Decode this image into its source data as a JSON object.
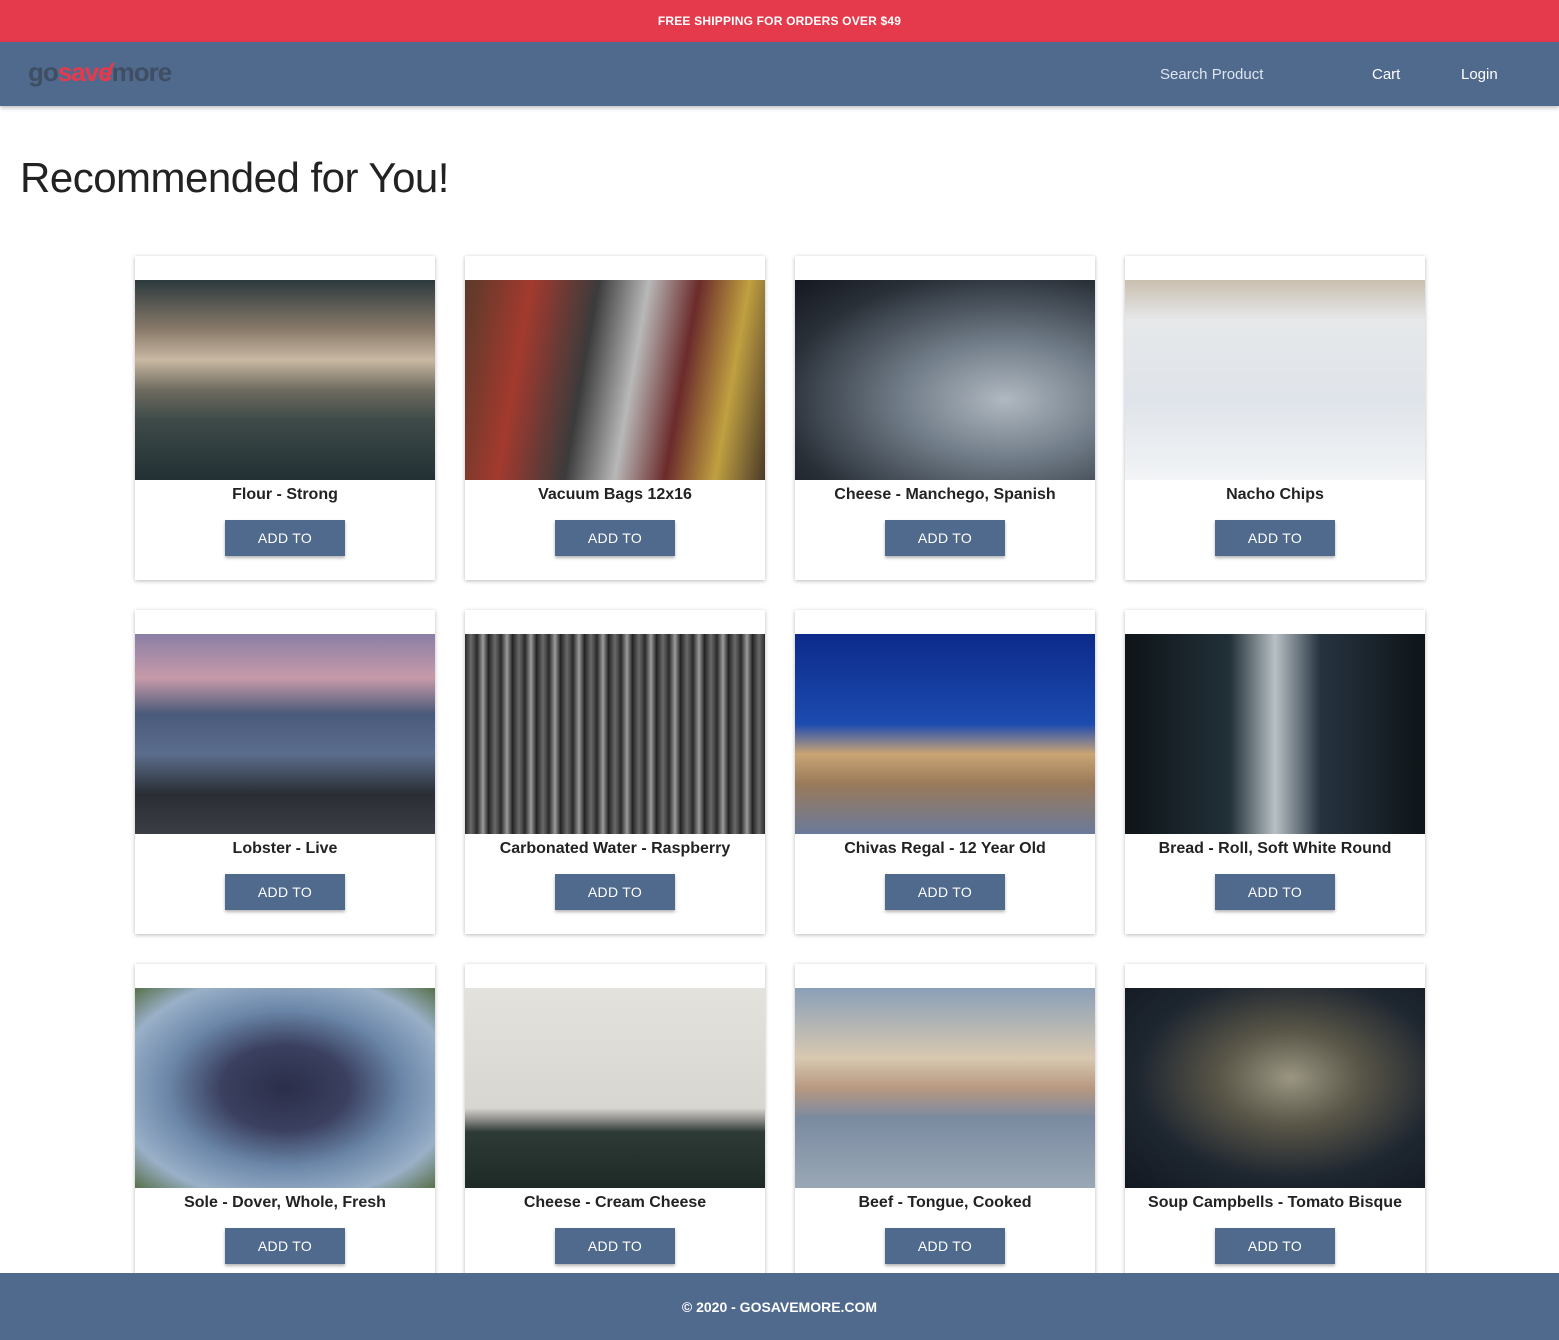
{
  "promo": {
    "text": "FREE SHIPPING FOR ORDERS OVER $49"
  },
  "header": {
    "logo": {
      "part1": "go",
      "part2": "save",
      "part3": "more"
    },
    "search_label": "Search Product",
    "cart_label": "Cart",
    "login_label": "Login"
  },
  "main": {
    "heading": "Recommended for You!",
    "products": [
      {
        "name": "Flour - Strong",
        "button": "ADD TO"
      },
      {
        "name": "Vacuum Bags 12x16",
        "button": "ADD TO"
      },
      {
        "name": "Cheese - Manchego, Spanish",
        "button": "ADD TO"
      },
      {
        "name": "Nacho Chips",
        "button": "ADD TO"
      },
      {
        "name": "Lobster - Live",
        "button": "ADD TO"
      },
      {
        "name": "Carbonated Water - Raspberry",
        "button": "ADD TO"
      },
      {
        "name": "Chivas Regal - 12 Year Old",
        "button": "ADD TO"
      },
      {
        "name": "Bread - Roll, Soft White Round",
        "button": "ADD TO"
      },
      {
        "name": "Sole - Dover, Whole, Fresh",
        "button": "ADD TO"
      },
      {
        "name": "Cheese - Cream Cheese",
        "button": "ADD TO"
      },
      {
        "name": "Beef - Tongue, Cooked",
        "button": "ADD TO"
      },
      {
        "name": "Soup Campbells - Tomato Bisque",
        "button": "ADD TO"
      }
    ]
  },
  "footer": {
    "text": "© 2020 - GOSAVEMORE.COM"
  },
  "colors": {
    "promo_bar": "#e53a4b",
    "navbar": "#506a8e",
    "button": "#506a8e",
    "logo_accent": "#e53a4b"
  }
}
